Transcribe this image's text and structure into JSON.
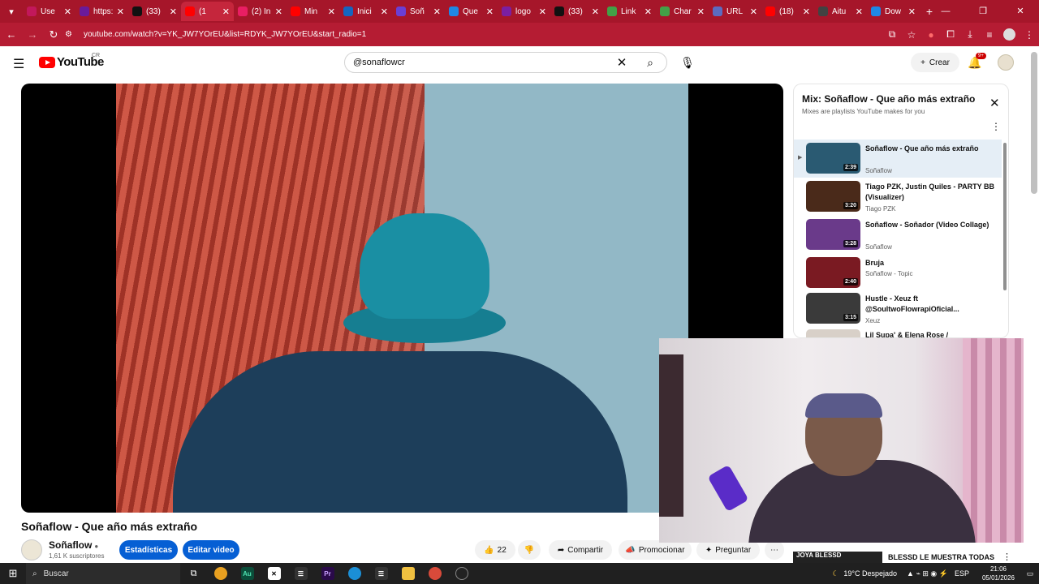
{
  "browser": {
    "tabs": [
      {
        "label": "Use",
        "color": "#c2185b"
      },
      {
        "label": "https:",
        "color": "#6a1b9a"
      },
      {
        "label": "(33)",
        "color": "#111111"
      },
      {
        "label": "(1",
        "color": "#ff0000",
        "active": true
      },
      {
        "label": "(2) In",
        "color": "#e91e63"
      },
      {
        "label": "Min",
        "color": "#ff0000"
      },
      {
        "label": "Inici",
        "color": "#1565c0"
      },
      {
        "label": "Soñ",
        "color": "#6a3fd4"
      },
      {
        "label": "Que",
        "color": "#1e88e5"
      },
      {
        "label": "logo",
        "color": "#7b1fa2"
      },
      {
        "label": "(33)",
        "color": "#111111"
      },
      {
        "label": "Link",
        "color": "#43a047"
      },
      {
        "label": "Char",
        "color": "#43a047"
      },
      {
        "label": "URL",
        "color": "#5c6bc0"
      },
      {
        "label": "(18)",
        "color": "#ff0000"
      },
      {
        "label": "Aitu",
        "color": "#424242"
      },
      {
        "label": "Dow",
        "color": "#1e88e5"
      }
    ],
    "url": "youtube.com/watch?v=YK_JW7YOrEU&list=RDYK_JW7YOrEU&start_radio=1"
  },
  "header": {
    "logo_text": "YouTube",
    "country_code": "CR",
    "search_value": "@sonaflowcr",
    "create_label": "Crear",
    "notification_badge": "9+"
  },
  "video": {
    "title": "Soñaflow - Que año más extraño",
    "channel": "Soñaflow",
    "subscribers": "1,61 K suscriptores",
    "stats_button": "Estadísticas",
    "edit_button": "Editar video",
    "likes": "22",
    "share_label": "Compartir",
    "promote_label": "Promocionar",
    "ask_label": "Preguntar"
  },
  "playlist": {
    "title": "Mix: Soñaflow - Que año más extraño",
    "subtitle": "Mixes are playlists YouTube makes for you",
    "items": [
      {
        "title": "Soñaflow - Que año más extraño",
        "channel": "Soñaflow",
        "duration": "2:39",
        "current": true,
        "thumb": "#2a5a72"
      },
      {
        "title": "Tiago PZK, Justin Quiles - PARTY BB (Visualizer)",
        "channel": "Tiago PZK",
        "duration": "3:20",
        "thumb": "#4a2a1a"
      },
      {
        "title": "Soñaflow - Soñador (Video Collage)",
        "channel": "Soñaflow",
        "duration": "3:28",
        "thumb": "#6a3a8a"
      },
      {
        "title": "Bruja",
        "channel": "Soñaflow - Topic",
        "duration": "2:40",
        "thumb": "#7a1a22"
      },
      {
        "title": "Hustle - Xeuz ft @SoultwoFlowrapiOficial...",
        "channel": "Xeuz",
        "duration": "3:15",
        "thumb": "#3a3a3a"
      },
      {
        "title": "Lil Supa' & Elena Rose /",
        "channel": "",
        "duration": "",
        "thumb": "#d8d0c8"
      }
    ]
  },
  "partial_recommendation": {
    "thumb_text": "JOYA BLESSD",
    "title": "BLESSD LE MUESTRA TODAS"
  },
  "taskbar": {
    "search_placeholder": "Buscar",
    "weather": "19°C  Despejado",
    "language": "ESP",
    "time": "21:06",
    "date": "05/01/2026"
  }
}
